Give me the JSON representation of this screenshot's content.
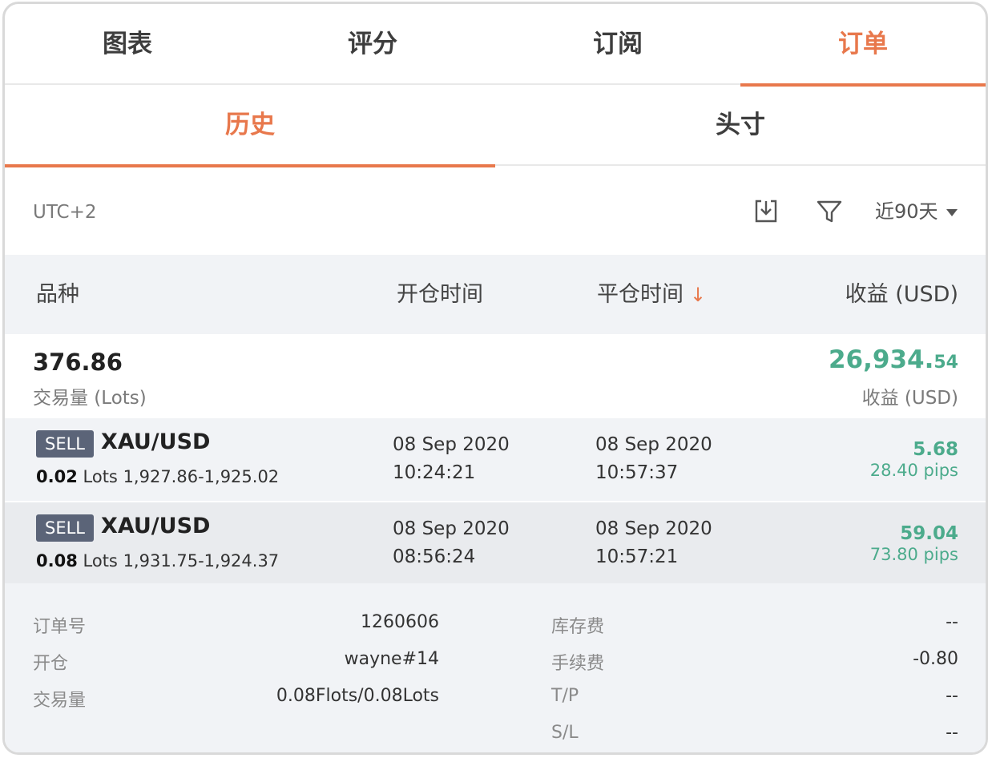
{
  "top_tabs": [
    "图表",
    "评分",
    "订阅",
    "订单"
  ],
  "sub_tabs": [
    "历史",
    "头寸"
  ],
  "toolbar": {
    "timezone": "UTC+2",
    "download_icon": "download-icon",
    "filter_icon": "filter-icon",
    "range": "近90天"
  },
  "table_header": {
    "symbol": "品种",
    "open_time": "开仓时间",
    "close_time": "平仓时间",
    "sort_arrow": "↓",
    "profit": "收益 (USD)"
  },
  "summary": {
    "lots": "376.86",
    "lots_label": "交易量 (Lots)",
    "profit_int": "26,934.",
    "profit_dec": "54",
    "profit_label": "收益 (USD)"
  },
  "trades": [
    {
      "side": "SELL",
      "symbol": "XAU/USD",
      "lots": "0.02",
      "lots_unit": "Lots",
      "price_range": "1,927.86-1,925.02",
      "open_date": "08 Sep 2020",
      "open_time": "10:24:21",
      "close_date": "08 Sep 2020",
      "close_time": "10:57:37",
      "profit": "5.68",
      "pips": "28.40 pips"
    },
    {
      "side": "SELL",
      "symbol": "XAU/USD",
      "lots": "0.08",
      "lots_unit": "Lots",
      "price_range": "1,931.75-1,924.37",
      "open_date": "08 Sep 2020",
      "open_time": "08:56:24",
      "close_date": "08 Sep 2020",
      "close_time": "10:57:21",
      "profit": "59.04",
      "pips": "73.80 pips"
    }
  ],
  "details": {
    "left": [
      {
        "label": "订单号",
        "value": "1260606"
      },
      {
        "label": "开仓",
        "value": "wayne#14"
      },
      {
        "label": "交易量",
        "value": "0.08Flots/0.08Lots"
      }
    ],
    "right": [
      {
        "label": "库存费",
        "value": "--"
      },
      {
        "label": "手续费",
        "value": "-0.80"
      },
      {
        "label": "T/P",
        "value": "--"
      },
      {
        "label": "S/L",
        "value": "--"
      }
    ]
  },
  "colors": {
    "accent": "#e8784c",
    "profit": "#4cab8c",
    "badge": "#5b6478"
  }
}
